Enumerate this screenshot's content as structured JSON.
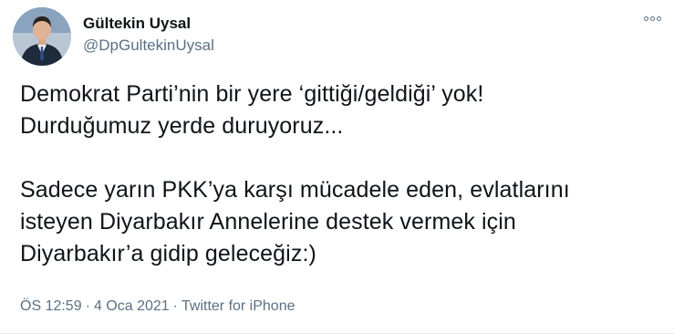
{
  "author": {
    "display_name": "Gültekin Uysal",
    "handle": "@DpGultekinUysal"
  },
  "tweet": {
    "paragraph1_line1": "Demokrat Parti’nin bir yere ‘gittiği/geldiği’ yok!",
    "paragraph1_line2": "Durduğumuz yerde duruyoruz...",
    "paragraph2_line1": "Sadece yarın PKK’ya karşı mücadele eden, evlatlarını",
    "paragraph2_line2": "isteyen Diyarbakır Annelerine destek vermek için",
    "paragraph2_line3": "Diyarbakır’a gidip geleceğiz:)"
  },
  "meta": {
    "time": "ÖS 12:59",
    "separator": "·",
    "date": "4 Oca 2021",
    "source": "Twitter for iPhone"
  },
  "icons": {
    "more": "more-options-icon",
    "avatar": "avatar"
  },
  "colors": {
    "text": "#0f1419",
    "secondary": "#5b7083"
  }
}
